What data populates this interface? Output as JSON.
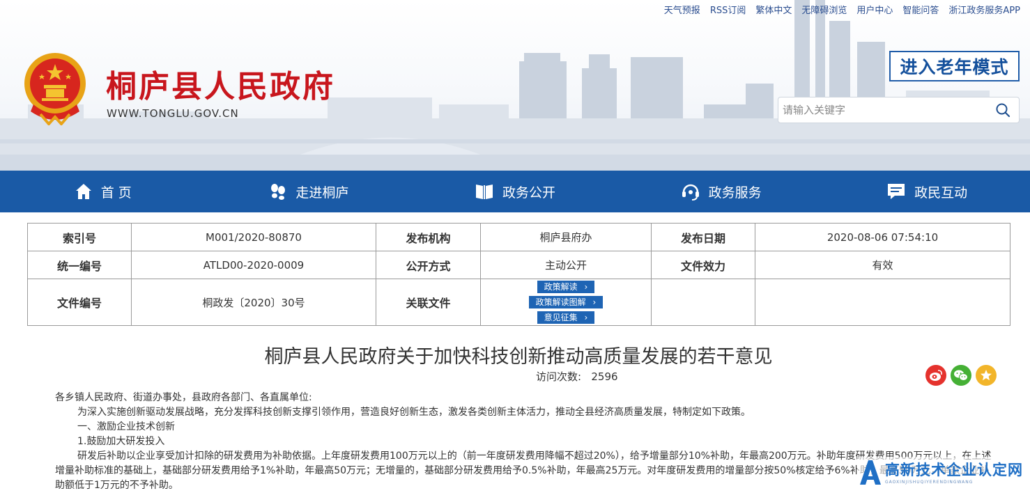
{
  "toplinks": [
    "天气预报",
    "RSS订阅",
    "繁体中文",
    "无障碍浏览",
    "用户中心",
    "智能问答",
    "浙江政务服务APP"
  ],
  "site": {
    "title": "桐庐县人民政府",
    "url": "WWW.TONGLU.GOV.CN"
  },
  "elder_mode": "进入老年模式",
  "search": {
    "placeholder": "请输入关键字"
  },
  "nav": [
    "首 页",
    "走进桐庐",
    "政务公开",
    "政务服务",
    "政民互动"
  ],
  "meta": {
    "index_label": "索引号",
    "index_value": "M001/2020-80870",
    "org_label": "发布机构",
    "org_value": "桐庐县府办",
    "date_label": "发布日期",
    "date_value": "2020-08-06 07:54:10",
    "unified_label": "统一编号",
    "unified_value": "ATLD00-2020-0009",
    "disclosure_label": "公开方式",
    "disclosure_value": "主动公开",
    "validity_label": "文件效力",
    "validity_value": "有效",
    "docno_label": "文件编号",
    "docno_value": "桐政发〔2020〕30号",
    "related_label": "关联文件",
    "related_links": [
      "政策解读",
      "政策解读图解",
      "意见征集"
    ]
  },
  "article": {
    "title": "桐庐县人民政府关于加快科技创新推动高质量发展的若干意见",
    "visits_label": "访问次数:",
    "visits_value": "2596",
    "paragraphs": [
      "各乡镇人民政府、街道办事处，县政府各部门、各直属单位:",
      "为深入实施创新驱动发展战略，充分发挥科技创新支撑引领作用，营造良好创新生态，激发各类创新主体活力，推动全县经济高质量发展，特制定如下政策。",
      "一、激励企业技术创新",
      "1.鼓励加大研发投入",
      "研发后补助以企业享受加计扣除的研发费用为补助依据。上年度研发费用100万元以上的（前一年度研发费用降幅不超过20%），给予增量部分10%补助，年最高200万元。补助年度研发费用500万元以上，在上述增量补助标准的基础上，基础部分研发费用给予1%补助，年最高50万元；无增量的，基础部分研发费用给予0.5%补助，年最高25万元。对年度研发费用的增量部分按50%核定给予6%补助，最高50万元，单家企业补助额低于1万元的不予补助。"
    ]
  },
  "watermark": {
    "main": "高新技术企业认定网",
    "sub": "GAOXINJISHUQIYERENDINGWANG"
  },
  "colors": {
    "nav_bg": "#1a5aa6",
    "title_red": "#c8161d",
    "link_blue": "#1e64b4"
  }
}
